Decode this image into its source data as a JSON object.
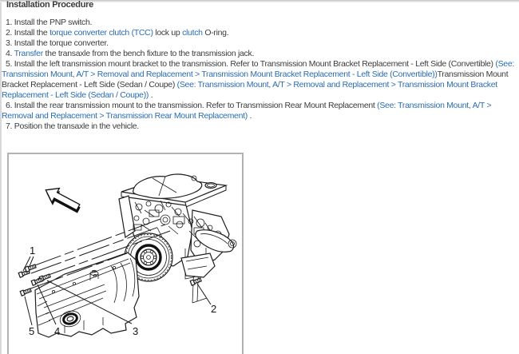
{
  "header": {
    "title": "Installation Procedure"
  },
  "steps": [
    {
      "num": "1.",
      "segments": [
        {
          "text": "Install the PNP switch.",
          "link": false
        }
      ]
    },
    {
      "num": "2.",
      "segments": [
        {
          "text": "Install the ",
          "link": false
        },
        {
          "text": "torque converter clutch (TCC)",
          "link": true
        },
        {
          "text": " lock up ",
          "link": false
        },
        {
          "text": "clutch",
          "link": true
        },
        {
          "text": " O-ring.",
          "link": false
        }
      ]
    },
    {
      "num": "3.",
      "segments": [
        {
          "text": "Install the torque converter.",
          "link": false
        }
      ]
    },
    {
      "num": "4.",
      "segments": [
        {
          "text": "Transfer",
          "link": true
        },
        {
          "text": " the transaxle from the bench fixture to the transmission jack.",
          "link": false
        }
      ]
    },
    {
      "num": "5.",
      "segments": [
        {
          "text": "Install the left transmission mount bracket to the transmission. Refer to Transmission Mount Bracket Replacement - Left Side (Convertible) ",
          "link": false
        },
        {
          "text": "(See: Transmission Mount, A/T > Removal and Replacement > Transmission Mount Bracket Replacement - Left Side (Convertible))",
          "link": true
        },
        {
          "text": "Transmission Mount Bracket Replacement - Left Side (Sedan / Coupe) ",
          "link": false
        },
        {
          "text": "(See: Transmission Mount, A/T > Removal and Replacement > Transmission Mount Bracket Replacement - Left Side (Sedan / Coupe))",
          "link": true
        },
        {
          "text": " .",
          "link": false
        }
      ]
    },
    {
      "num": "6.",
      "segments": [
        {
          "text": "Install the rear transmission mount to the transmission. Refer to Transmission Rear Mount Replacement ",
          "link": false
        },
        {
          "text": "(See: Transmission Mount, A/T > Removal and Replacement > Transmission Rear Mount Replacement)",
          "link": true
        },
        {
          "text": " .",
          "link": false
        }
      ]
    },
    {
      "num": "7.",
      "segments": [
        {
          "text": "Position the transaxle in the vehicle.",
          "link": false
        }
      ]
    }
  ],
  "figure": {
    "callouts": [
      "1",
      "2",
      "3",
      "4",
      "5"
    ],
    "arrow_icon": "up-left-direction-arrow"
  },
  "colors": {
    "link": "#2b6cb0",
    "text": "#3c3c3c",
    "title": "#3a3a3a",
    "figure_border": "#b1b1b6"
  }
}
